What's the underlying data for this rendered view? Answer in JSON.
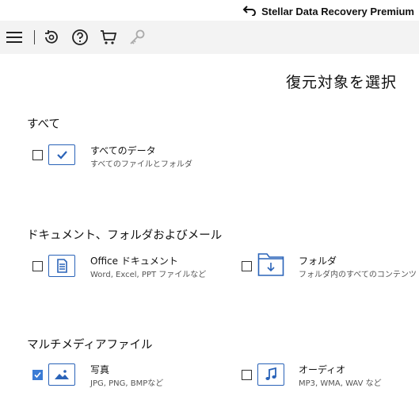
{
  "titlebar": {
    "app_name": "Stellar Data Recovery Premium",
    "logo_icon": "back-arrow-logo-icon"
  },
  "toolbar": {
    "items": [
      {
        "icon": "hamburger-menu-icon"
      },
      {
        "icon": "recover-history-icon"
      },
      {
        "icon": "help-icon"
      },
      {
        "icon": "cart-icon"
      },
      {
        "icon": "key-icon",
        "state": "disabled"
      }
    ]
  },
  "main": {
    "heading": "復元対象を選択",
    "sections": [
      {
        "title": "すべて",
        "options": [
          {
            "label": "すべてのデータ",
            "desc": "すべてのファイルとフォルダ",
            "checked": false,
            "icon": "checkmark-tile-icon"
          }
        ]
      },
      {
        "title": "ドキュメント、フォルダおよびメール",
        "options": [
          {
            "label": "Office ドキュメント",
            "desc": "Word, Excel, PPT ファイルなど",
            "checked": false,
            "icon": "document-icon"
          },
          {
            "label": "フォルダ",
            "desc": "フォルダ内のすべてのコンテンツ",
            "checked": false,
            "icon": "folder-icon"
          }
        ]
      },
      {
        "title": "マルチメディアファイル",
        "options": [
          {
            "label": "写真",
            "desc": "JPG, PNG, BMPなど",
            "checked": true,
            "icon": "photo-icon"
          },
          {
            "label": "オーディオ",
            "desc": "MP3, WMA, WAV など",
            "checked": false,
            "icon": "music-note-icon"
          }
        ]
      }
    ]
  },
  "colors": {
    "accent": "#2a63b8",
    "checkbox_checked": "#3a7bd5",
    "toolbar_bg": "#f3f3f3"
  }
}
